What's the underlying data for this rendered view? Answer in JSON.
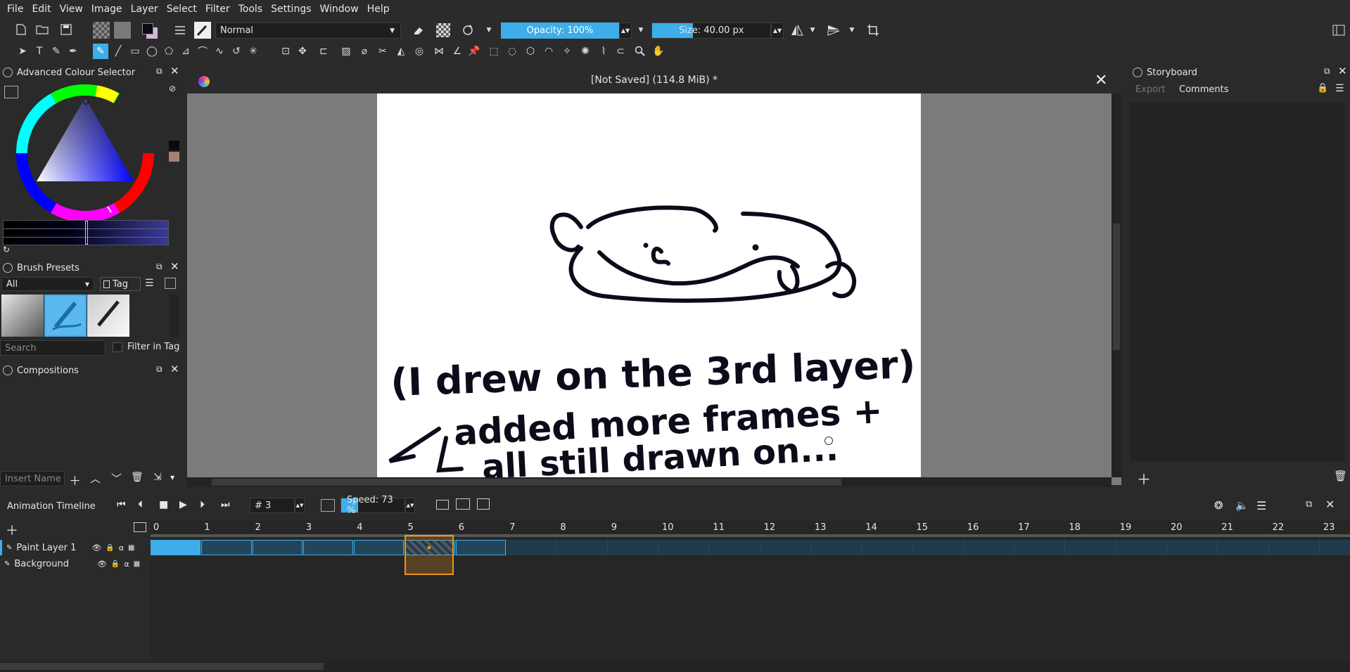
{
  "menu": [
    "File",
    "Edit",
    "View",
    "Image",
    "Layer",
    "Select",
    "Filter",
    "Tools",
    "Settings",
    "Window",
    "Help"
  ],
  "toolbar": {
    "blend_mode": "Normal",
    "opacity": "Opacity: 100%",
    "size": "Size: 40.00 px"
  },
  "colour_selector": {
    "title": "Advanced Colour Selector"
  },
  "brush_presets": {
    "title": "Brush Presets",
    "filter": "All",
    "tag": "Tag",
    "search_placeholder": "Search",
    "filter_in_tag": "Filter in Tag"
  },
  "compositions": {
    "title": "Compositions",
    "insert_placeholder": "Insert Name"
  },
  "document": {
    "title": "[Not Saved]  (114.8 MiB) *",
    "handwriting": [
      "(I drew on the 3rd layer)",
      "added more frames +",
      "all still drawn on..."
    ]
  },
  "storyboard": {
    "title": "Storyboard",
    "export": "Export",
    "comments": "Comments"
  },
  "timeline": {
    "title": "Animation Timeline",
    "frame_number": "# 3",
    "speed": "Speed: 73 %",
    "ruler": [
      "0",
      "1",
      "2",
      "3",
      "4",
      "5",
      "6",
      "7",
      "8",
      "9",
      "10",
      "11",
      "12",
      "13",
      "14",
      "15",
      "16",
      "17",
      "18",
      "19",
      "20",
      "21",
      "22",
      "23"
    ],
    "layers": [
      "Paint Layer 1",
      "Background"
    ]
  },
  "colors": {
    "accent": "#3daee9",
    "current_frame": "#f0931d",
    "bg": "#2a2a2a"
  }
}
